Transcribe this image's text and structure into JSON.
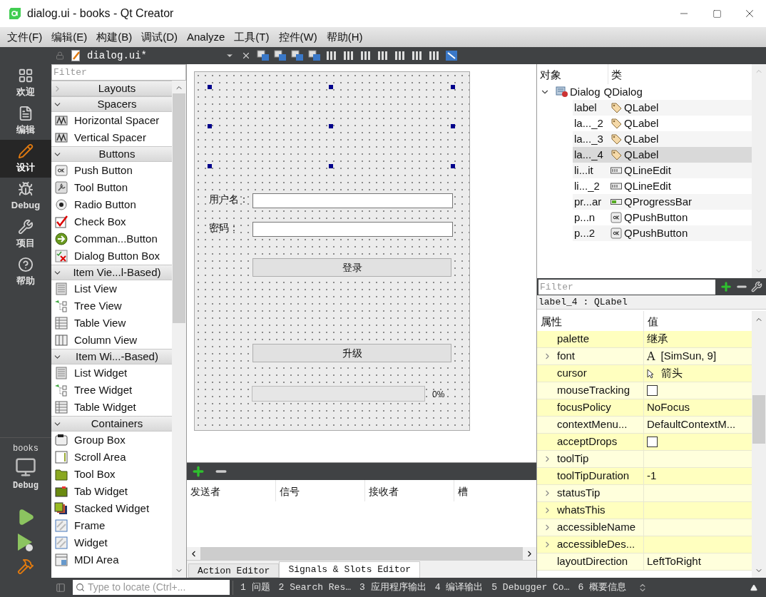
{
  "window": {
    "title": "dialog.ui - books - Qt Creator"
  },
  "menu": [
    "文件(F)",
    "编辑(E)",
    "构建(B)",
    "调试(D)",
    "Analyze",
    "工具(T)",
    "控件(W)",
    "帮助(H)"
  ],
  "editor_toolbar": {
    "file": "dialog.ui*"
  },
  "mode_bar": {
    "modes": [
      {
        "label": "欢迎",
        "selected": false
      },
      {
        "label": "编辑",
        "selected": false
      },
      {
        "label": "设计",
        "selected": true
      },
      {
        "label": "Debug",
        "selected": false
      },
      {
        "label": "项目",
        "selected": false
      },
      {
        "label": "帮助",
        "selected": false
      }
    ],
    "kit": {
      "project": "books",
      "build": "Debug"
    }
  },
  "widget_box": {
    "filter_placeholder": "Filter",
    "categories": [
      {
        "title": "Layouts",
        "expanded": false
      },
      {
        "title": "Spacers",
        "expanded": true,
        "items": [
          "Horizontal Spacer",
          "Vertical Spacer"
        ]
      },
      {
        "title": "Buttons",
        "expanded": true,
        "items": [
          "Push Button",
          "Tool Button",
          "Radio Button",
          "Check Box",
          "Comman...Button",
          "Dialog Button Box"
        ]
      },
      {
        "title": "Item Vie...l-Based)",
        "expanded": true,
        "items": [
          "List View",
          "Tree View",
          "Table View",
          "Column View"
        ]
      },
      {
        "title": "Item Wi...-Based)",
        "expanded": true,
        "items": [
          "List Widget",
          "Tree Widget",
          "Table Widget"
        ]
      },
      {
        "title": "Containers",
        "expanded": true,
        "items": [
          "Group Box",
          "Scroll Area",
          "Tool Box",
          "Tab Widget",
          "Stacked Widget",
          "Frame",
          "Widget",
          "MDI Area"
        ]
      }
    ]
  },
  "form": {
    "fields": [
      "用户名：",
      "密码："
    ],
    "buttons": [
      "登录",
      "升级"
    ],
    "progress": {
      "level": 0,
      "text": "0%"
    }
  },
  "signal_slot_editor": {
    "columns": [
      "发送者",
      "信号",
      "接收者",
      "槽"
    ],
    "tabs": [
      {
        "label": "Action Editor",
        "selected": false
      },
      {
        "label": "Signals & Slots Editor",
        "selected": true
      }
    ]
  },
  "object_inspector": {
    "columns": [
      "对象",
      "类"
    ],
    "root": {
      "name": "Dialog",
      "class": "QDialog",
      "expanded": true,
      "children": [
        {
          "name": "label",
          "class": "QLabel",
          "kind": "label",
          "selected": false
        },
        {
          "name": "la..._2",
          "class": "QLabel",
          "kind": "label",
          "selected": false
        },
        {
          "name": "la..._3",
          "class": "QLabel",
          "kind": "label",
          "selected": false
        },
        {
          "name": "la..._4",
          "class": "QLabel",
          "kind": "label",
          "selected": true
        },
        {
          "name": "li...it",
          "class": "QLineEdit",
          "kind": "lineedit",
          "selected": false
        },
        {
          "name": "li..._2",
          "class": "QLineEdit",
          "kind": "lineedit",
          "selected": false
        },
        {
          "name": "pr...ar",
          "class": "QProgressBar",
          "kind": "progressbar",
          "selected": false
        },
        {
          "name": "p...n",
          "class": "QPushButton",
          "kind": "pushbutton",
          "selected": false
        },
        {
          "name": "p...2",
          "class": "QPushButton",
          "kind": "pushbutton",
          "selected": false
        }
      ]
    }
  },
  "property_editor": {
    "filter_placeholder": "Filter",
    "current": "label_4 : QLabel",
    "columns": [
      "属性",
      "值"
    ],
    "rows": [
      {
        "name": "palette",
        "kind": "text",
        "value": "继承",
        "expandable": false
      },
      {
        "name": "font",
        "kind": "font",
        "glyph": "A",
        "value": "[SimSun, 9]",
        "expandable": true
      },
      {
        "name": "cursor",
        "kind": "cursor",
        "value": "箭头",
        "expandable": false
      },
      {
        "name": "mouseTracking",
        "kind": "checkbox",
        "checked": false,
        "expandable": false
      },
      {
        "name": "focusPolicy",
        "kind": "text",
        "value": "NoFocus",
        "expandable": false
      },
      {
        "name": "contextMenu...",
        "kind": "text",
        "value": "DefaultContextM...",
        "expandable": false
      },
      {
        "name": "acceptDrops",
        "kind": "checkbox",
        "checked": false,
        "expandable": false
      },
      {
        "name": "toolTip",
        "kind": "empty",
        "expandable": true
      },
      {
        "name": "toolTipDuration",
        "kind": "text",
        "value": "-1",
        "expandable": false
      },
      {
        "name": "statusTip",
        "kind": "empty",
        "expandable": true
      },
      {
        "name": "whatsThis",
        "kind": "empty",
        "expandable": true
      },
      {
        "name": "accessibleName",
        "kind": "empty",
        "expandable": true
      },
      {
        "name": "accessibleDes...",
        "kind": "empty",
        "expandable": true
      },
      {
        "name": "layoutDirection",
        "kind": "text",
        "value": "LeftToRight",
        "expandable": false
      }
    ]
  },
  "status_bar": {
    "locator_placeholder": "Type to locate (Ctrl+...",
    "panes": [
      "1 问题",
      "2 Search Res…",
      "3 应用程序输出",
      "4 编译输出",
      "5 Debugger Co…",
      "6 概要信息"
    ]
  }
}
